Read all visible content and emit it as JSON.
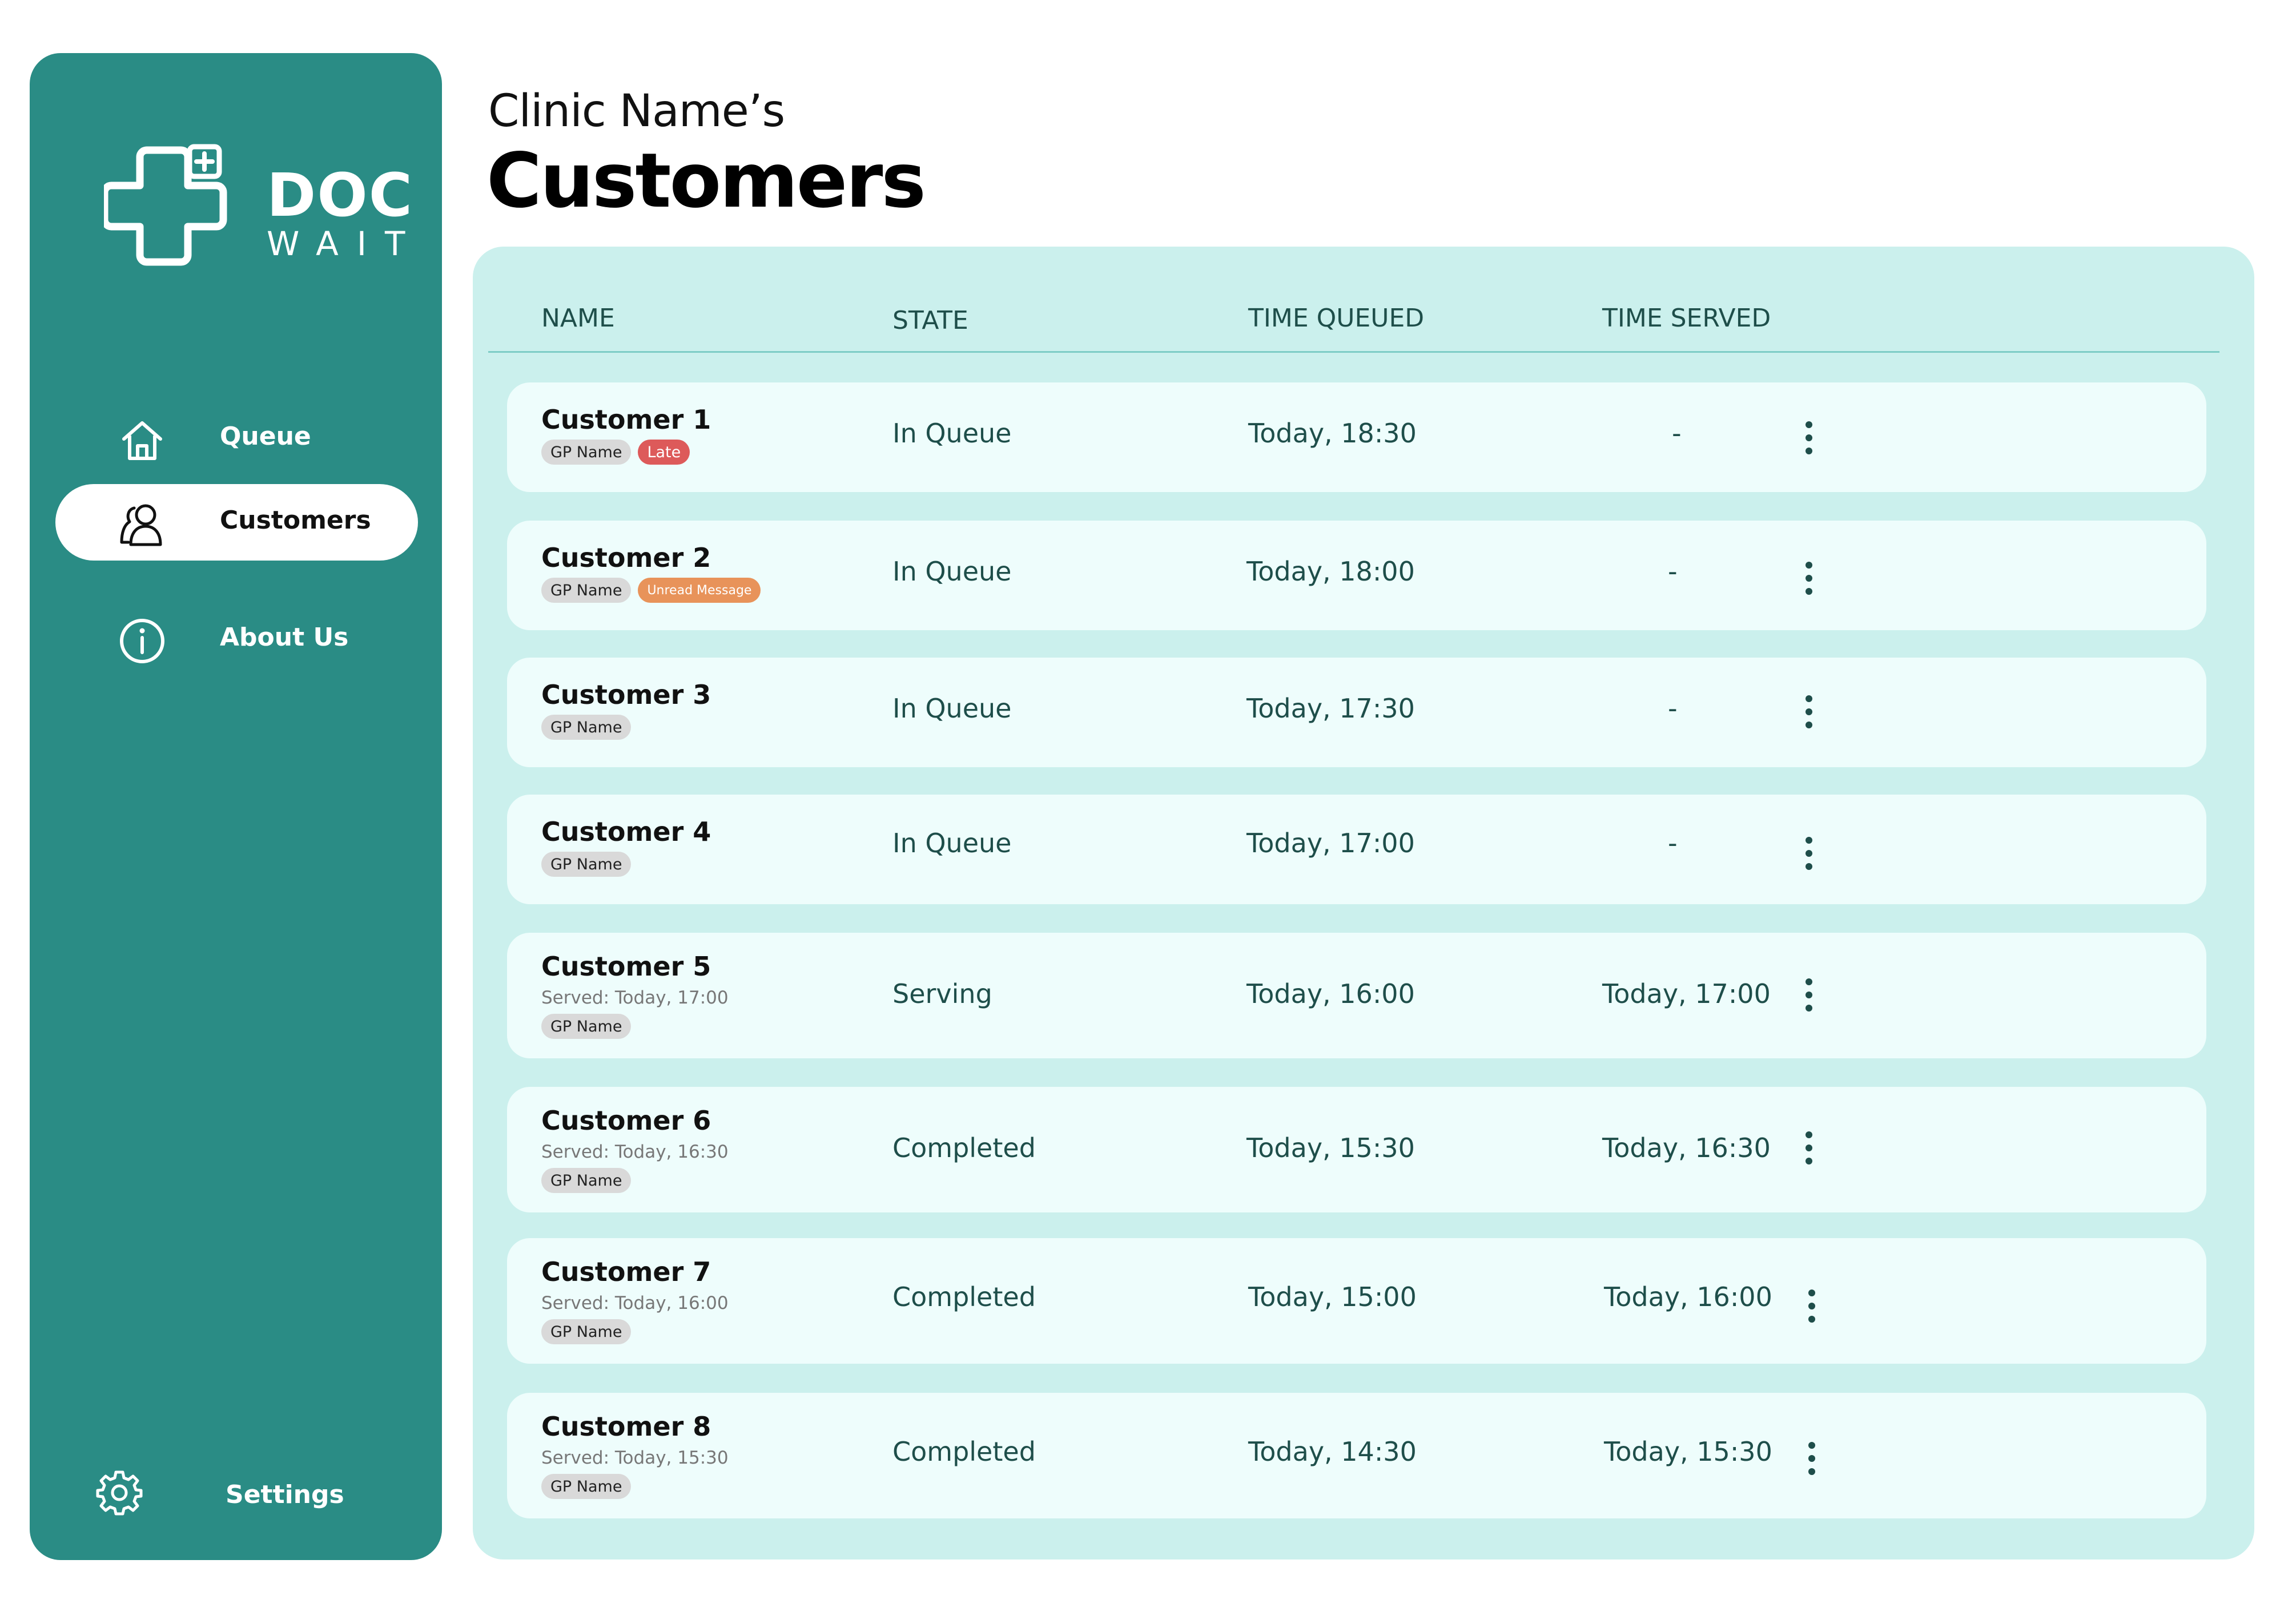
{
  "sidebar": {
    "logo": {
      "line1": "DOC",
      "line2": "WAIT",
      "icon": "medical-cross-plus-icon"
    },
    "nav": [
      {
        "label": "Queue",
        "icon": "home-icon",
        "active": false
      },
      {
        "label": "Customers",
        "icon": "users-icon",
        "active": true
      },
      {
        "label": "About Us",
        "icon": "info-icon",
        "active": false
      }
    ],
    "settings": {
      "label": "Settings",
      "icon": "gear-icon"
    }
  },
  "header": {
    "clinic_name": "Clinic Name’s",
    "title": "Customers"
  },
  "table": {
    "columns": [
      "NAME",
      "STATE",
      "TIME QUEUED",
      "TIME SERVED"
    ],
    "rows": [
      {
        "name": "Customer 1",
        "served_note": "",
        "badges": [
          "GP Name",
          "Late"
        ],
        "state": "In Queue",
        "time_queued": "Today, 18:30",
        "time_served": "-"
      },
      {
        "name": "Customer 2",
        "served_note": "",
        "badges": [
          "GP Name",
          "Unread Message"
        ],
        "state": "In Queue",
        "time_queued": "Today, 18:00",
        "time_served": "-"
      },
      {
        "name": "Customer 3",
        "served_note": "",
        "badges": [
          "GP Name"
        ],
        "state": "In Queue",
        "time_queued": "Today, 17:30",
        "time_served": "-"
      },
      {
        "name": "Customer 4",
        "served_note": "",
        "badges": [
          "GP Name"
        ],
        "state": "In Queue",
        "time_queued": "Today, 17:00",
        "time_served": "-"
      },
      {
        "name": "Customer 5",
        "served_note": "Served: Today, 17:00",
        "badges": [
          "GP Name"
        ],
        "state": "Serving",
        "time_queued": "Today, 16:00",
        "time_served": "Today, 17:00"
      },
      {
        "name": "Customer 6",
        "served_note": "Served: Today, 16:30",
        "badges": [
          "GP Name"
        ],
        "state": "Completed",
        "time_queued": "Today, 15:30",
        "time_served": "Today, 16:30"
      },
      {
        "name": "Customer 7",
        "served_note": "Served: Today, 16:00",
        "badges": [
          "GP Name"
        ],
        "state": "Completed",
        "time_queued": "Today, 15:00",
        "time_served": "Today, 16:00"
      },
      {
        "name": "Customer 8",
        "served_note": "Served: Today, 15:30",
        "badges": [
          "GP Name"
        ],
        "state": "Completed",
        "time_queued": "Today, 14:30",
        "time_served": "Today, 15:30"
      }
    ],
    "row_action_icon": "more-vertical-icon"
  },
  "colors": {
    "sidebar_bg": "#2a8c85",
    "panel_bg": "#cbf0ed",
    "row_bg": "#eefdfc",
    "late_badge": "#dd5a5a",
    "unread_badge": "#e8935a",
    "gp_badge": "#d9d9d9"
  }
}
